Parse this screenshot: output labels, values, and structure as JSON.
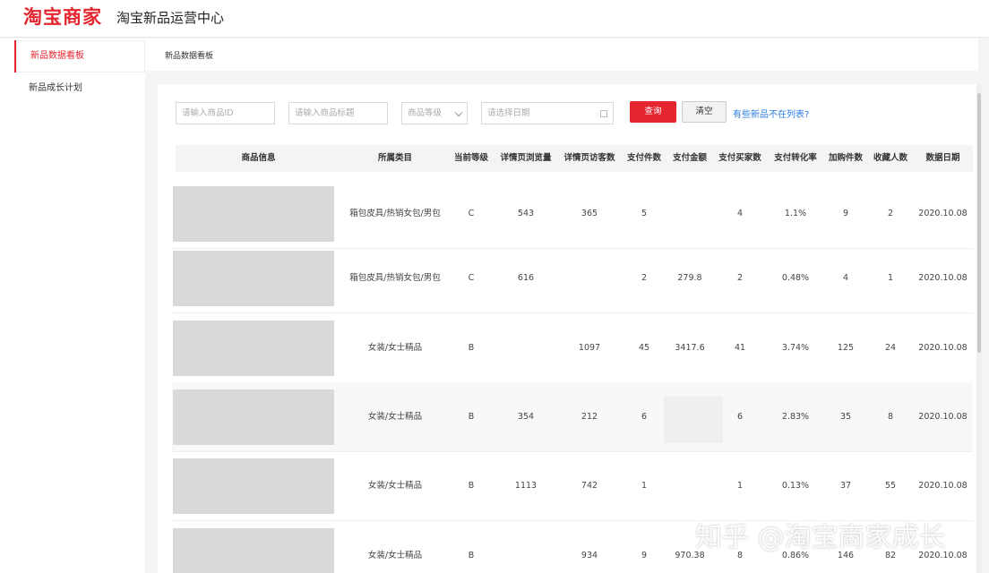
{
  "header": {
    "brand": "淘宝商家",
    "subtitle": "淘宝新品运营中心"
  },
  "sidebar": {
    "items": [
      {
        "label": "新品数据看板",
        "active": true
      },
      {
        "label": "新品成长计划",
        "active": false
      }
    ]
  },
  "breadcrumb": "新品数据看板",
  "filters": {
    "product_id_placeholder": "请输入商品ID",
    "product_title_placeholder": "请输入商品标题",
    "grade_select": "商品等级",
    "date_placeholder": "请选择日期",
    "query_label": "查询",
    "clear_label": "清空",
    "missing_link": "有些新品不在列表?"
  },
  "table": {
    "columns": [
      "商品信息",
      "所属类目",
      "当前等级",
      "详情页浏览量",
      "详情页访客数",
      "支付件数",
      "支付金额",
      "支付买家数",
      "支付转化率",
      "加购件数",
      "收藏人数",
      "数据日期"
    ],
    "rows": [
      [
        "",
        "箱包皮具/热销女包/男包",
        "C",
        "543",
        "365",
        "5",
        "",
        "4",
        "1.1%",
        "9",
        "2",
        "2020.10.08"
      ],
      [
        "",
        "箱包皮具/热销女包/男包",
        "C",
        "616",
        "",
        "2",
        "279.8",
        "2",
        "0.48%",
        "4",
        "1",
        "2020.10.08"
      ],
      [
        "",
        "女装/女士精品",
        "B",
        "",
        "1097",
        "45",
        "3417.6",
        "41",
        "3.74%",
        "125",
        "24",
        "2020.10.08"
      ],
      [
        "",
        "女装/女士精品",
        "B",
        "354",
        "212",
        "6",
        "",
        "6",
        "2.83%",
        "35",
        "8",
        "2020.10.08"
      ],
      [
        "",
        "女装/女士精品",
        "B",
        "1113",
        "742",
        "1",
        "",
        "1",
        "0.13%",
        "37",
        "55",
        "2020.10.08"
      ],
      [
        "",
        "女装/女士精品",
        "B",
        "",
        "934",
        "9",
        "970.38",
        "8",
        "0.86%",
        "146",
        "82",
        "2020.10.08"
      ]
    ]
  },
  "watermark": "知乎 @淘宝商家成长"
}
